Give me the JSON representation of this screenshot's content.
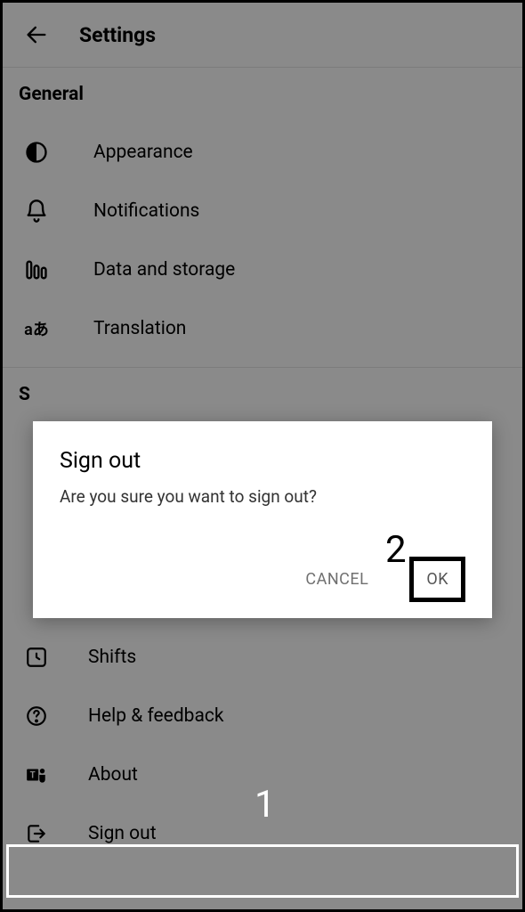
{
  "header": {
    "title": "Settings"
  },
  "general": {
    "heading": "General",
    "appearance": "Appearance",
    "notifications": "Notifications",
    "data_storage": "Data and storage",
    "translation": "Translation"
  },
  "second_heading_visible": "S",
  "lower": {
    "shifts": "Shifts",
    "help": "Help & feedback",
    "about": "About",
    "signout": "Sign out"
  },
  "dialog": {
    "title": "Sign out",
    "message": "Are you sure you want to sign out?",
    "cancel": "CANCEL",
    "ok": "OK"
  },
  "annotations": {
    "one": "1",
    "two": "2"
  }
}
